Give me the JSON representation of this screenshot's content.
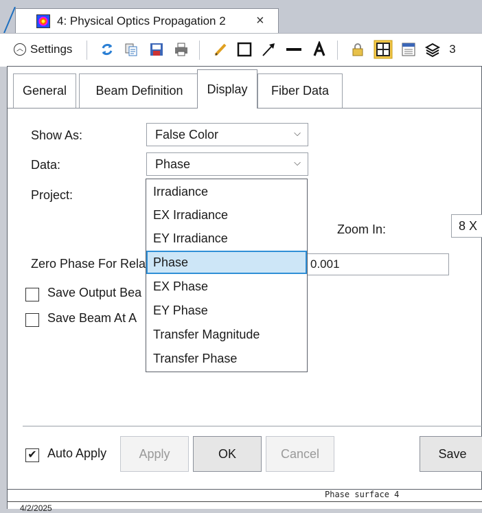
{
  "tab": {
    "title": "4: Physical Optics Propagation 2",
    "close_icon": "×"
  },
  "toolbar": {
    "settings_label": "Settings",
    "trailing_text": "3",
    "icons": [
      "refresh-icon",
      "copy-icon",
      "save-image-icon",
      "print-icon",
      "pencil-icon",
      "rectangle-icon",
      "arrow-icon",
      "line-icon",
      "text-icon",
      "lock-icon",
      "grid-icon",
      "layout-icon",
      "layers-icon"
    ]
  },
  "panel_tabs": [
    "General",
    "Beam Definition",
    "Display",
    "Fiber Data"
  ],
  "form": {
    "show_as_label": "Show As:",
    "show_as_value": "False Color",
    "data_label": "Data:",
    "data_value": "Phase",
    "project_label": "Project:",
    "zoom_label": "Zoom In:",
    "zoom_value": "8 X",
    "zero_phase_label": "Zero Phase For Rela",
    "zero_phase_value": "0.001",
    "save_output_label": "Save Output Bea",
    "save_beam_label": "Save Beam At A",
    "auto_apply_label": "Auto Apply",
    "auto_apply_checked": true
  },
  "dropdown_options": [
    "Irradiance",
    "EX Irradiance",
    "EY Irradiance",
    "Phase",
    "EX Phase",
    "EY Phase",
    "Transfer Magnitude",
    "Transfer Phase"
  ],
  "dropdown_selected": "Phase",
  "buttons": {
    "apply": "Apply",
    "ok": "OK",
    "cancel": "Cancel",
    "save": "Save"
  },
  "status": {
    "caption": "Phase surface 4",
    "date": "4/2/2025"
  },
  "colors": {
    "selection_fill": "#cde6f7",
    "selection_border": "#2f8fd6",
    "tab_accent": "#1e6fbf"
  }
}
